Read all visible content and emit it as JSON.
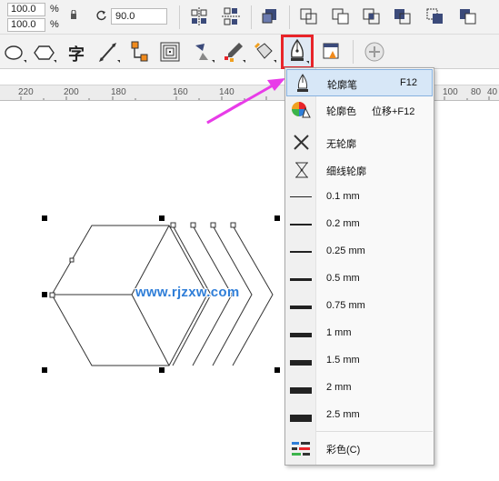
{
  "toolbar": {
    "width_value": "100.0",
    "height_value": "100.0",
    "width_unit": "%",
    "height_unit": "%",
    "angle_value": "90.0",
    "text_tool_glyph": "字"
  },
  "ruler": {
    "labels": [
      "220",
      "200",
      "180",
      "160",
      "140",
      "100",
      "80",
      "60",
      "40"
    ]
  },
  "watermark": {
    "text": "www.rjzxw.com"
  },
  "outline_menu": {
    "items": [
      {
        "label": "轮廓笔",
        "shortcut": "F12",
        "icon": "outline-pen-icon"
      },
      {
        "label": "轮廓色",
        "shortcut": "位移+F12",
        "icon": "outline-color-icon"
      },
      {
        "label": "无轮廓",
        "icon": "no-outline-icon"
      },
      {
        "label": "细线轮廓",
        "icon": "hairline-outline-icon"
      },
      {
        "label": "0.1 mm",
        "weight": 0.1
      },
      {
        "label": "0.2 mm",
        "weight": 0.2
      },
      {
        "label": "0.25 mm",
        "weight": 0.25
      },
      {
        "label": "0.5 mm",
        "weight": 0.5
      },
      {
        "label": "0.75 mm",
        "weight": 0.75
      },
      {
        "label": "1 mm",
        "weight": 1
      },
      {
        "label": "1.5 mm",
        "weight": 1.5
      },
      {
        "label": "2 mm",
        "weight": 2
      },
      {
        "label": "2.5 mm",
        "weight": 2.5
      },
      {
        "label": "彩色(C)",
        "icon": "color-docker-icon"
      }
    ]
  },
  "colors": {
    "highlight_border": "#e8242a",
    "arrow": "#e83ce8",
    "watermark": "#2f7ed8"
  }
}
